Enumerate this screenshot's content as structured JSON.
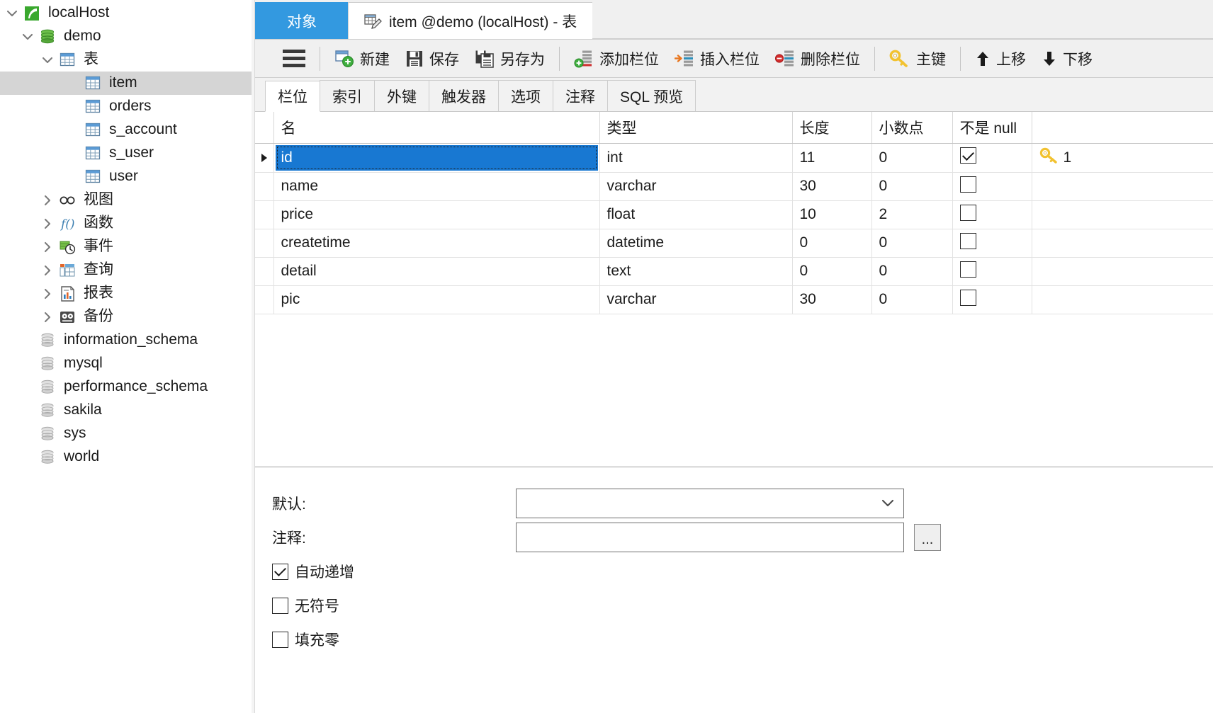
{
  "sidebar": {
    "items": [
      {
        "label": "localHost",
        "icon": "connection-icon",
        "twisty": "down",
        "level": 0,
        "selected": false
      },
      {
        "label": "demo",
        "icon": "database-icon",
        "twisty": "down",
        "level": 1,
        "selected": false
      },
      {
        "label": "表",
        "icon": "tables-folder-icon",
        "twisty": "down",
        "level": 2,
        "selected": false
      },
      {
        "label": "item",
        "icon": "table-icon",
        "twisty": "",
        "level": 3,
        "selected": true
      },
      {
        "label": "orders",
        "icon": "table-icon",
        "twisty": "",
        "level": 3,
        "selected": false
      },
      {
        "label": "s_account",
        "icon": "table-icon",
        "twisty": "",
        "level": 3,
        "selected": false
      },
      {
        "label": "s_user",
        "icon": "table-icon",
        "twisty": "",
        "level": 3,
        "selected": false
      },
      {
        "label": "user",
        "icon": "table-icon",
        "twisty": "",
        "level": 3,
        "selected": false
      },
      {
        "label": "视图",
        "icon": "view-icon",
        "twisty": "right",
        "level": 2,
        "selected": false
      },
      {
        "label": "函数",
        "icon": "function-icon",
        "twisty": "right",
        "level": 2,
        "selected": false
      },
      {
        "label": "事件",
        "icon": "event-icon",
        "twisty": "right",
        "level": 2,
        "selected": false
      },
      {
        "label": "查询",
        "icon": "query-icon",
        "twisty": "right",
        "level": 2,
        "selected": false
      },
      {
        "label": "报表",
        "icon": "report-icon",
        "twisty": "right",
        "level": 2,
        "selected": false
      },
      {
        "label": "备份",
        "icon": "backup-icon",
        "twisty": "right",
        "level": 2,
        "selected": false
      },
      {
        "label": "information_schema",
        "icon": "database-gray-icon",
        "twisty": "",
        "level": 1,
        "selected": false
      },
      {
        "label": "mysql",
        "icon": "database-gray-icon",
        "twisty": "",
        "level": 1,
        "selected": false
      },
      {
        "label": "performance_schema",
        "icon": "database-gray-icon",
        "twisty": "",
        "level": 1,
        "selected": false
      },
      {
        "label": "sakila",
        "icon": "database-gray-icon",
        "twisty": "",
        "level": 1,
        "selected": false
      },
      {
        "label": "sys",
        "icon": "database-gray-icon",
        "twisty": "",
        "level": 1,
        "selected": false
      },
      {
        "label": "world",
        "icon": "database-gray-icon",
        "twisty": "",
        "level": 1,
        "selected": false
      }
    ]
  },
  "window_tabs": {
    "object_tab": "对象",
    "doc_tab": "item @demo (localHost) - 表"
  },
  "toolbar": {
    "menu_icon": "hamburger-menu-icon",
    "buttons": [
      {
        "label": "新建",
        "icon": "new-icon"
      },
      {
        "label": "保存",
        "icon": "save-icon"
      },
      {
        "label": "另存为",
        "icon": "save-as-icon"
      },
      {
        "label": "添加栏位",
        "icon": "add-field-icon"
      },
      {
        "label": "插入栏位",
        "icon": "insert-field-icon"
      },
      {
        "label": "删除栏位",
        "icon": "delete-field-icon"
      },
      {
        "label": "主键",
        "icon": "primary-key-icon"
      },
      {
        "label": "上移",
        "icon": "move-up-icon"
      },
      {
        "label": "下移",
        "icon": "move-down-icon"
      }
    ]
  },
  "inner_tabs": [
    {
      "label": "栏位",
      "active": true
    },
    {
      "label": "索引",
      "active": false
    },
    {
      "label": "外键",
      "active": false
    },
    {
      "label": "触发器",
      "active": false
    },
    {
      "label": "选项",
      "active": false
    },
    {
      "label": "注释",
      "active": false
    },
    {
      "label": "SQL 预览",
      "active": false
    }
  ],
  "grid": {
    "columns": [
      "名",
      "类型",
      "长度",
      "小数点",
      "不是 null",
      ""
    ],
    "rows": [
      {
        "name": "id",
        "type": "int",
        "length": "11",
        "decimals": "0",
        "not_null": true,
        "key": "1",
        "selected": true
      },
      {
        "name": "name",
        "type": "varchar",
        "length": "30",
        "decimals": "0",
        "not_null": false,
        "key": "",
        "selected": false
      },
      {
        "name": "price",
        "type": "float",
        "length": "10",
        "decimals": "2",
        "not_null": false,
        "key": "",
        "selected": false
      },
      {
        "name": "createtime",
        "type": "datetime",
        "length": "0",
        "decimals": "0",
        "not_null": false,
        "key": "",
        "selected": false
      },
      {
        "name": "detail",
        "type": "text",
        "length": "0",
        "decimals": "0",
        "not_null": false,
        "key": "",
        "selected": false
      },
      {
        "name": "pic",
        "type": "varchar",
        "length": "30",
        "decimals": "0",
        "not_null": false,
        "key": "",
        "selected": false
      }
    ]
  },
  "form": {
    "default_label": "默认:",
    "default_value": "",
    "comment_label": "注释:",
    "comment_value": "",
    "browse_label": "...",
    "checkboxes": [
      {
        "label": "自动递增",
        "checked": true
      },
      {
        "label": "无符号",
        "checked": false
      },
      {
        "label": "填充零",
        "checked": false
      }
    ]
  },
  "colors": {
    "accent": "#3399e0",
    "selection": "#1878d2",
    "toolbar_bg": "#f0f0f0",
    "key_gold": "#f2c230"
  }
}
